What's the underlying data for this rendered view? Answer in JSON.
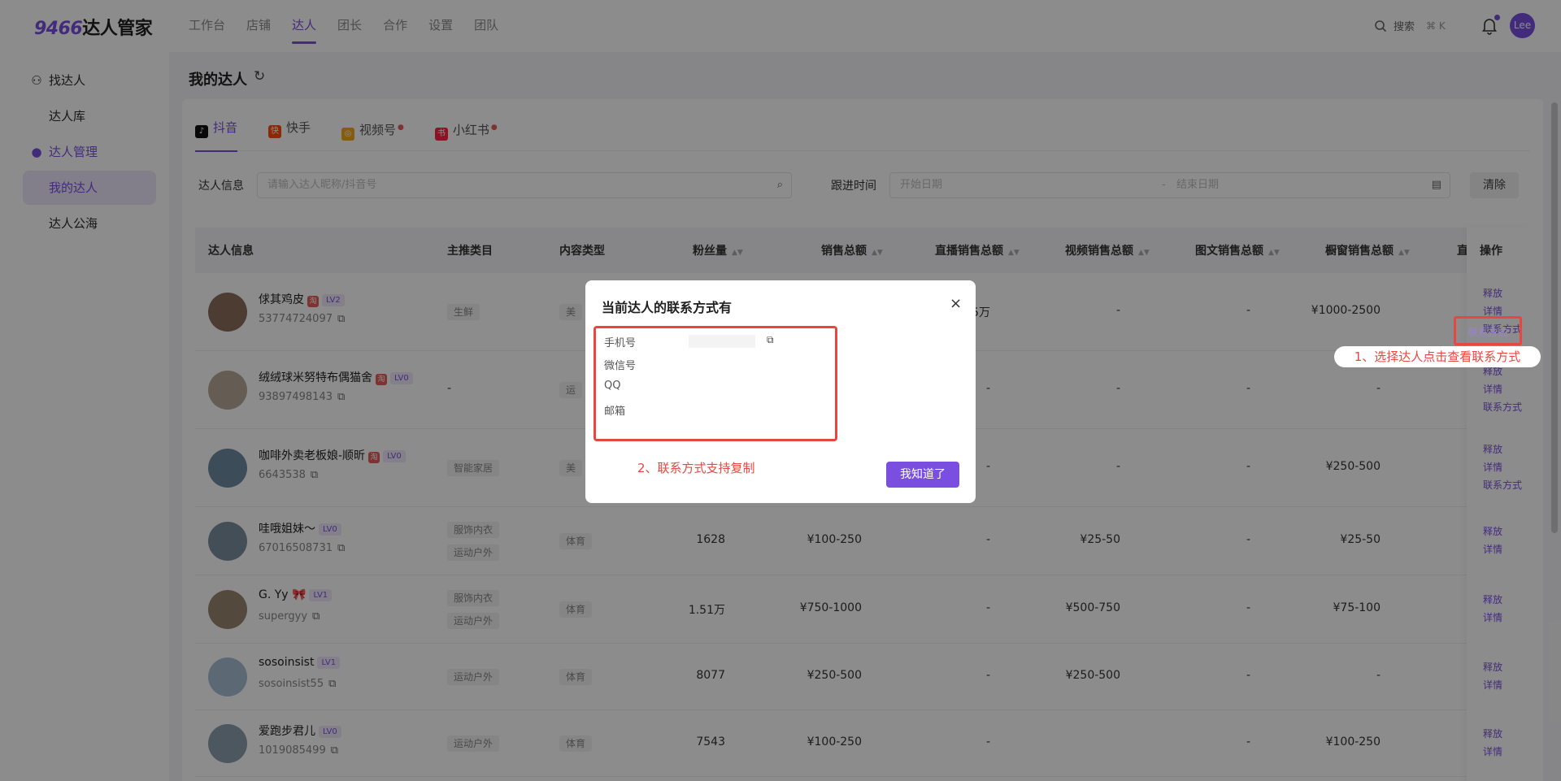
{
  "header": {
    "logo_num": "9466",
    "logo_text": "达人管家",
    "nav": [
      "工作台",
      "店铺",
      "达人",
      "团长",
      "合作",
      "设置",
      "团队"
    ],
    "active_nav": "达人",
    "search_label": "搜索",
    "search_shortcut": "⌘ K",
    "avatar_text": "Lee"
  },
  "sidebar": {
    "find_kol": "找达人",
    "kol_library": "达人库",
    "kol_manage": "达人管理",
    "my_kol": "我的达人",
    "kol_pool": "达人公海"
  },
  "page": {
    "title": "我的达人"
  },
  "platform_tabs": [
    {
      "label": "抖音",
      "color": "#111111"
    },
    {
      "label": "快手",
      "color": "#ff4906"
    },
    {
      "label": "视频号",
      "color": "#f5a623"
    },
    {
      "label": "小红书",
      "color": "#ff2442"
    }
  ],
  "filters": {
    "kol_info_label": "达人信息",
    "kol_info_placeholder": "请输入达人昵称/抖音号",
    "follow_time_label": "跟进时间",
    "start_placeholder": "开始日期",
    "end_placeholder": "结束日期",
    "range_sep": "-",
    "clear": "清除"
  },
  "table": {
    "columns": [
      "达人信息",
      "主推类目",
      "内容类型",
      "粉丝量",
      "销售总额",
      "直播销售总额",
      "视频销售总额",
      "图文销售总额",
      "橱窗销售总额",
      "直",
      "操作"
    ],
    "rows": [
      {
        "name": "俅其鸡皮",
        "lv": "LV2",
        "id": "53774724097",
        "cats": [
          "生鲜"
        ],
        "content": "美",
        "fans": "",
        "sales": "",
        "live": "-2.5万",
        "video": "-",
        "image": "-",
        "window": "¥1000-2500",
        "ops": [
          "释放",
          "详情",
          "联系方式"
        ],
        "tb": true
      },
      {
        "name": "绒绒球米努特布偶猫舍",
        "lv": "LV0",
        "id": "93897498143",
        "cats": [],
        "cat_text": "-",
        "content": "运",
        "fans": "",
        "sales": "",
        "live": "-",
        "video": "-",
        "image": "-",
        "window": "-",
        "ops": [
          "释放",
          "详情",
          "联系方式"
        ],
        "tb": true
      },
      {
        "name": "咖啡外卖老板娘-顺昕",
        "lv": "LV0",
        "id": "6643538",
        "cats": [
          "智能家居"
        ],
        "content": "美",
        "fans": "",
        "sales": "",
        "live": "-",
        "video": "-",
        "image": "-",
        "window": "¥250-500",
        "ops": [
          "释放",
          "详情",
          "联系方式"
        ],
        "tb": true
      },
      {
        "name": "哇哦姐妹～",
        "lv": "LV0",
        "id": "67016508731",
        "cats": [
          "服饰内衣",
          "运动户外"
        ],
        "content": "体育",
        "fans": "1628",
        "sales": "¥100-250",
        "live": "-",
        "video": "¥25-50",
        "image": "-",
        "window": "¥25-50",
        "ops": [
          "释放",
          "详情"
        ]
      },
      {
        "name": "G. Yy 🎀",
        "lv": "LV1",
        "id": "supergyy",
        "cats": [
          "服饰内衣",
          "运动户外"
        ],
        "content": "体育",
        "fans": "1.51万",
        "sales": "¥750-1000",
        "live": "-",
        "video": "¥500-750",
        "image": "-",
        "window": "¥75-100",
        "ops": [
          "释放",
          "详情"
        ]
      },
      {
        "name": "sosoinsist",
        "lv": "LV1",
        "id": "sosoinsist55",
        "cats": [
          "运动户外"
        ],
        "content": "体育",
        "fans": "8077",
        "sales": "¥250-500",
        "live": "-",
        "video": "¥250-500",
        "image": "-",
        "window": "-",
        "ops": [
          "释放",
          "详情"
        ]
      },
      {
        "name": "爱跑步君儿",
        "lv": "LV0",
        "id": "1019085499",
        "cats": [
          "运动户外"
        ],
        "content": "体育",
        "fans": "7543",
        "sales": "¥100-250",
        "live": "-",
        "video": "",
        "image": "-",
        "window": "¥100-250",
        "ops": [
          "释放",
          "详情"
        ]
      }
    ]
  },
  "modal": {
    "title": "当前达人的联系方式有",
    "fields": [
      "手机号",
      "微信号",
      "QQ",
      "邮箱"
    ],
    "note": "2、联系方式支持复制",
    "ok": "我知道了"
  },
  "callout": {
    "highlight_op": "联系方式",
    "text": "1、选择达人点击查看联系方式"
  }
}
